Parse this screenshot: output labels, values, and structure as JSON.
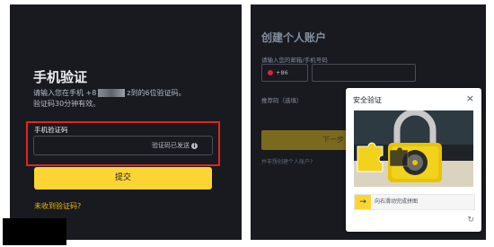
{
  "left": {
    "title": "手机验证",
    "desc_line1_a": "请输入您在手机 +8",
    "desc_line1_b": "z到的6位验证码。",
    "desc_line2": "验证码30分钟有效。",
    "field_label": "手机验证码",
    "field_hint": "验证码已发送",
    "submit_label": "提交",
    "no_code_link": "未收到验证码?"
  },
  "right": {
    "title": "创建个人账户",
    "phone_label": "请输入您的邮箱/手机号码",
    "country_code": "+86",
    "referral": "推荐码（选填）",
    "next_btn": "下一步",
    "footer_text": "并非想创建个人账户?"
  },
  "modal": {
    "title": "安全验证",
    "close_icon": "close-icon",
    "slider_text": "向右滑动完成拼图",
    "slider_icon": "arrow-right-icon",
    "refresh_icon": "refresh-icon"
  },
  "colors": {
    "bg_dark": "#181a20",
    "accent": "#fcd535",
    "highlight": "#e02424"
  }
}
